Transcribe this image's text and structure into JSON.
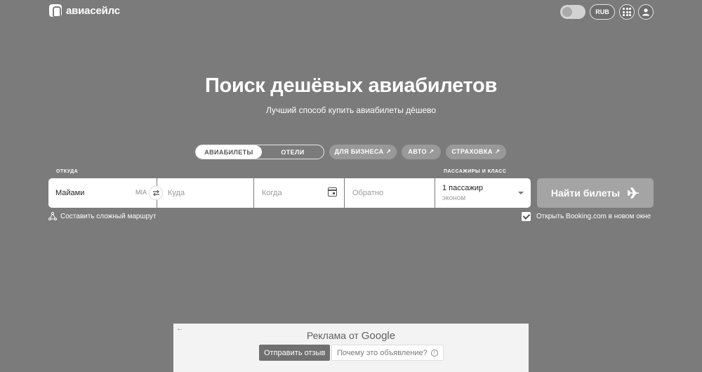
{
  "header": {
    "logo_text": "авиасейлс",
    "currency": "RUB"
  },
  "hero": {
    "title": "Поиск дешёвых авиабилетов",
    "subtitle": "Лучший способ купить авиабилеты дёшево"
  },
  "tabs": [
    {
      "label": "АВИАБИЛЕТЫ",
      "active": true
    },
    {
      "label": "ОТЕЛИ",
      "active": false
    }
  ],
  "links": [
    {
      "label": "ДЛЯ БИЗНЕСА ↗"
    },
    {
      "label": "АВТО ↗"
    },
    {
      "label": "СТРАХОВКА ↗"
    }
  ],
  "form": {
    "from_label": "ОТКУДА",
    "from_value": "Майами",
    "from_code": "MIA",
    "to_placeholder": "Куда",
    "when_placeholder": "Когда",
    "return_placeholder": "Обратно",
    "pax_label": "ПАССАЖИРЫ И КЛАСС",
    "pax_value": "1 пассажир",
    "pax_class": "эконом",
    "search_button": "Найти билеты",
    "complex_route": "Составить сложный маршрут",
    "booking_checkbox": "Открыть Booking.com в новом окне",
    "booking_checked": true
  },
  "ad": {
    "title_prefix": "Реклама от",
    "title_brand": "Google",
    "feedback_button": "Отправить отзыв",
    "why_button": "Почему это объявление?"
  }
}
